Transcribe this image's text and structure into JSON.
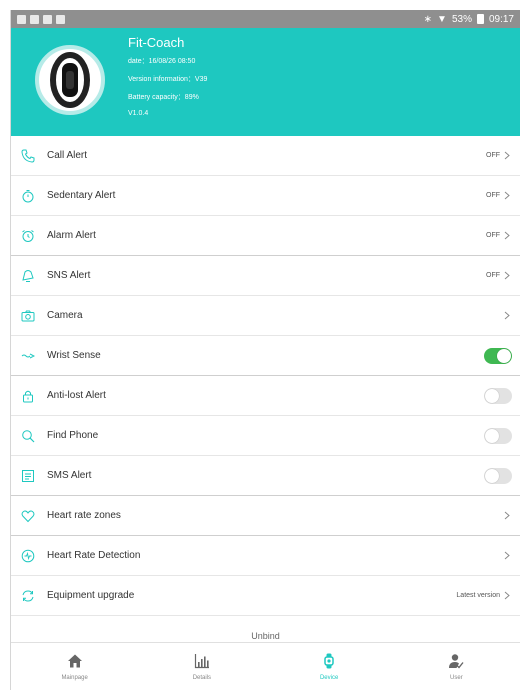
{
  "status_bar": {
    "battery": "53%",
    "time": "09:17"
  },
  "header": {
    "device_name": "Fit-Coach",
    "date": "date：16/08/26 08:50",
    "version_information": "Version information：V39",
    "battery_capacity": "Battery capacity：89%",
    "app_version": "V1.0.4"
  },
  "colors": {
    "accent": "#1ec8c0",
    "toggle_on": "#3fb852"
  },
  "items": [
    {
      "label": "Call Alert",
      "icon": "phone-icon",
      "value": "OFF"
    },
    {
      "label": "Sedentary Alert",
      "icon": "stopwatch-icon",
      "value": "OFF"
    },
    {
      "label": "Alarm Alert",
      "icon": "alarm-clock-icon",
      "value": "OFF"
    },
    {
      "label": "SNS Alert",
      "icon": "bell-icon",
      "value": "OFF"
    },
    {
      "label": "Camera",
      "icon": "camera-icon"
    },
    {
      "label": "Wrist Sense",
      "icon": "wrist-sense-icon",
      "toggle": "on"
    },
    {
      "label": "Anti-lost Alert",
      "icon": "lock-icon",
      "toggle": "off"
    },
    {
      "label": "Find Phone",
      "icon": "search-icon",
      "toggle": "off"
    },
    {
      "label": "SMS Alert",
      "icon": "sms-icon",
      "toggle": "off"
    },
    {
      "label": "Heart rate zones",
      "icon": "heart-icon"
    },
    {
      "label": "Heart Rate Detection",
      "icon": "heart-rate-icon"
    },
    {
      "label": "Equipment upgrade",
      "icon": "refresh-icon",
      "value": "Latest version"
    }
  ],
  "unbind_label": "Unbind",
  "tabs": [
    {
      "label": "Mainpage",
      "icon": "home-icon"
    },
    {
      "label": "Details",
      "icon": "chart-icon"
    },
    {
      "label": "Device",
      "icon": "watch-icon",
      "active": true
    },
    {
      "label": "User",
      "icon": "user-icon"
    }
  ]
}
